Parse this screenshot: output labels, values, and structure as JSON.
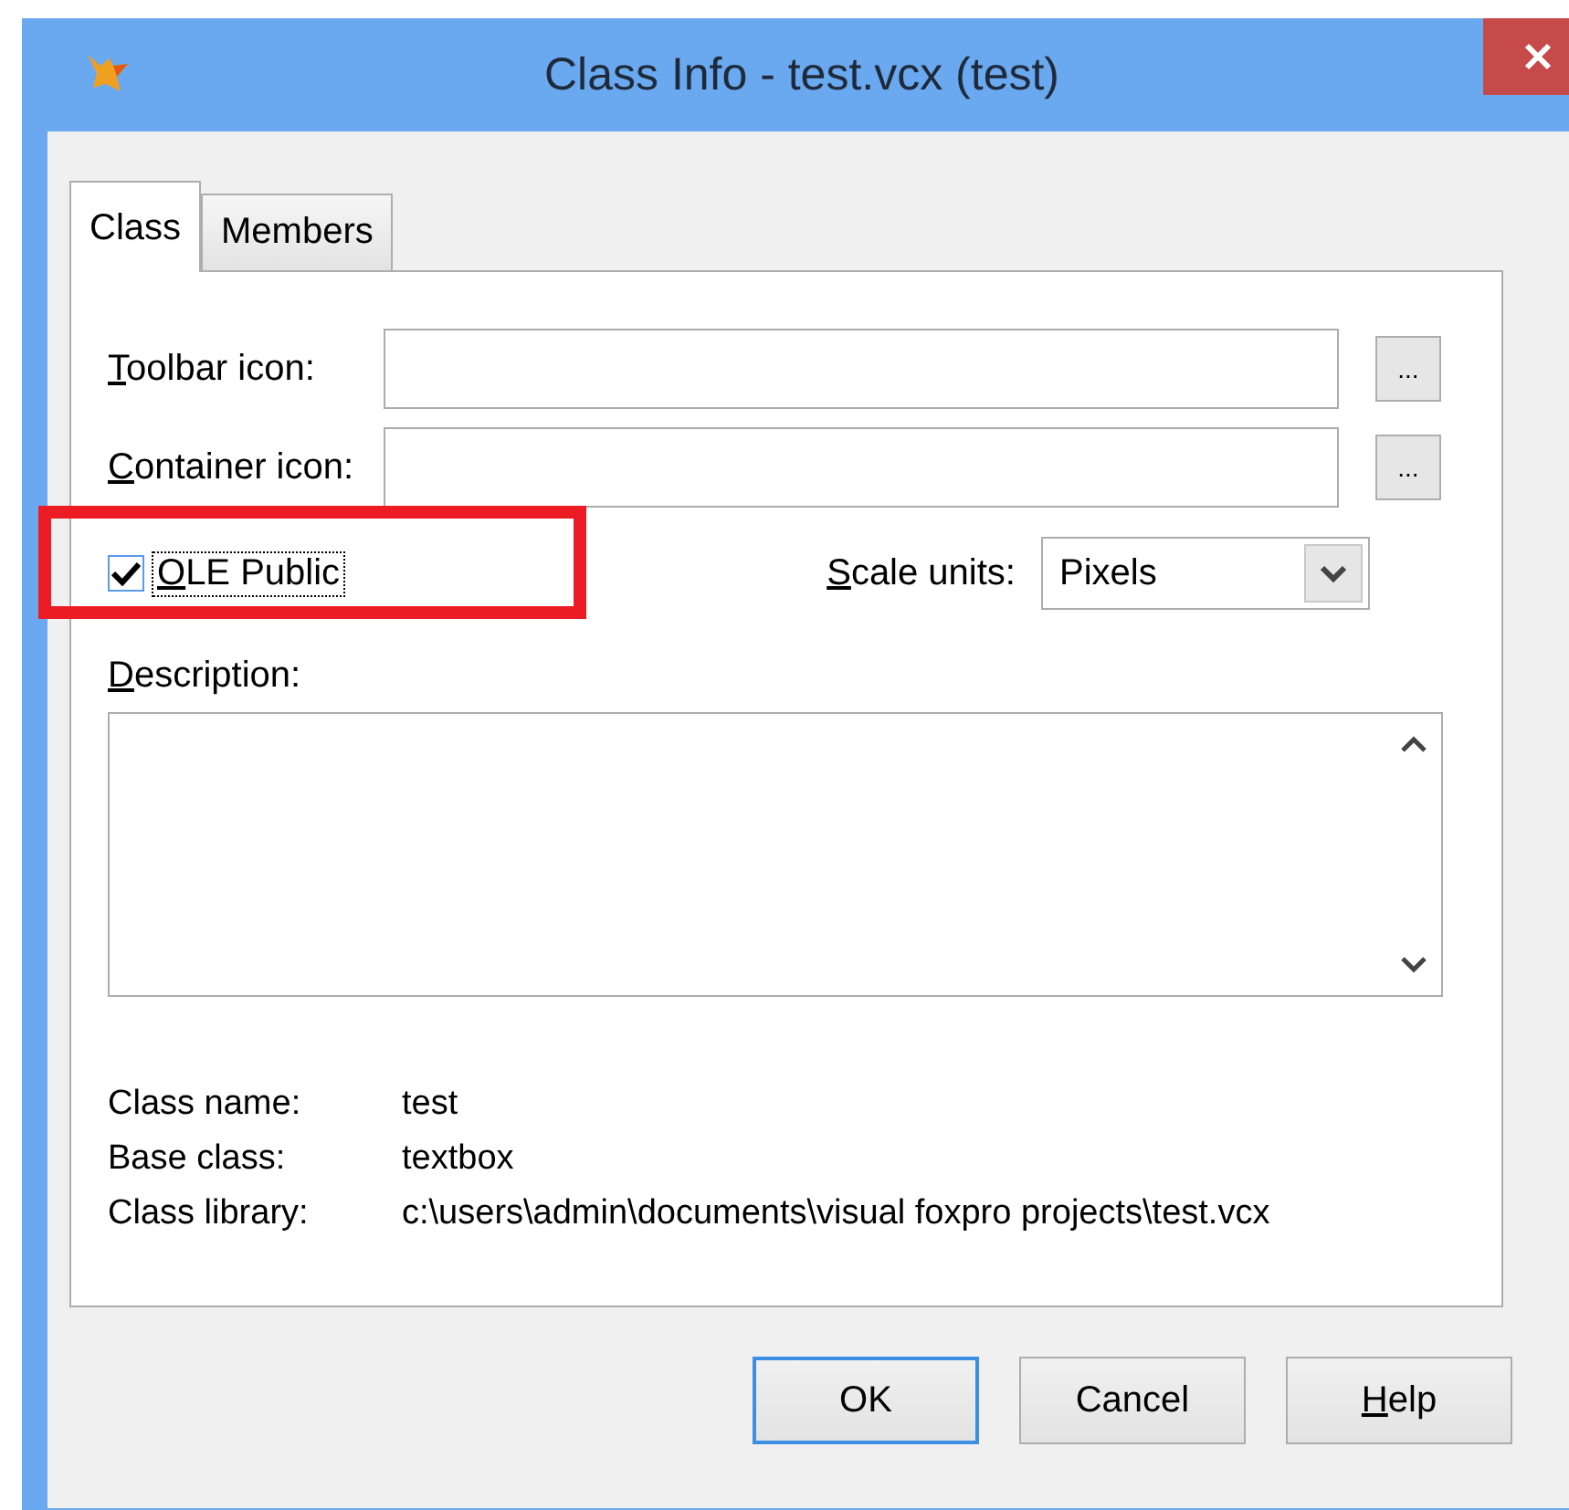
{
  "window": {
    "title": "Class Info - test.vcx (test)"
  },
  "tabs": [
    {
      "label": "Class",
      "selected": true
    },
    {
      "label": "Members",
      "selected": false
    }
  ],
  "fields": [
    {
      "label": "Toolbar icon:",
      "underline_first": true,
      "browse": "..."
    },
    {
      "label": "Container icon:",
      "underline_first": true,
      "browse": "..."
    }
  ],
  "ole_public": {
    "label": "OLE Public",
    "underline_first": true,
    "checked": true,
    "focused": true,
    "highlighted": true
  },
  "scale_units": {
    "label": "Scale units:",
    "underline_first": true,
    "value": "Pixels"
  },
  "description": {
    "label": "Description:",
    "underline_first": true
  },
  "info": [
    {
      "label": "Class name:",
      "value": "test"
    },
    {
      "label": "Base class:",
      "value": "textbox"
    },
    {
      "label": "Class library:",
      "value": "c:\\users\\admin\\documents\\visual foxpro projects\\test.vcx"
    }
  ],
  "buttons": [
    {
      "label": "OK",
      "default": true,
      "underline_first": false
    },
    {
      "label": "Cancel",
      "default": false,
      "underline_first": false
    },
    {
      "label": "Help",
      "default": false,
      "underline_first": true
    }
  ]
}
